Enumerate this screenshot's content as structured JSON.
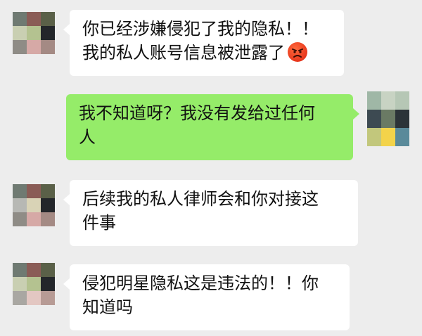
{
  "chat": {
    "messages": [
      {
        "side": "left",
        "lines": [
          "你已经涉嫌侵犯了我的隐私！！",
          "我的私人账号信息被泄露了"
        ],
        "emoji": "angry-face-icon"
      },
      {
        "side": "right",
        "lines": [
          "我不知道呀？我没有发给过任何",
          "人"
        ]
      },
      {
        "side": "left",
        "lines": [
          "后续我的私人律师会和你对接这",
          "件事"
        ]
      },
      {
        "side": "left",
        "lines": [
          "侵犯明星隐私这是违法的！！你",
          "知道吗"
        ]
      }
    ]
  },
  "colors": {
    "background": "#ededed",
    "incoming_bubble": "#ffffff",
    "outgoing_bubble": "#95ec69"
  }
}
